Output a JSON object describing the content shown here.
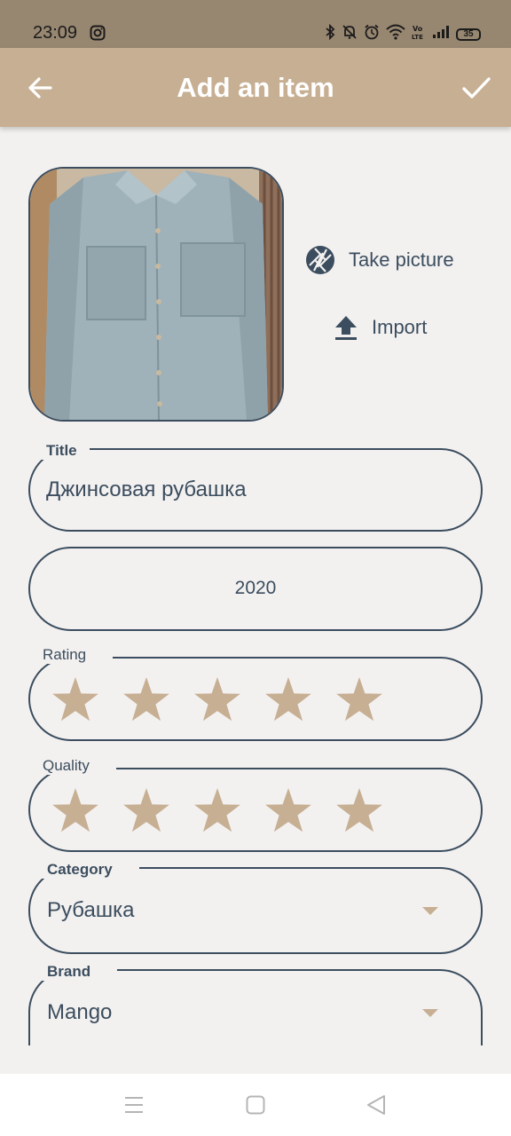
{
  "status_bar": {
    "time": "23:09",
    "battery": "35",
    "icons": [
      "instagram-icon",
      "bluetooth-icon",
      "mute-icon",
      "alarm-icon",
      "wifi-icon",
      "volte-icon",
      "signal-icon",
      "battery-icon"
    ]
  },
  "app_bar": {
    "title": "Add an item",
    "back_icon": "arrow-left-icon",
    "confirm_icon": "check-icon"
  },
  "photo": {
    "alt_icon": "shirt-photo"
  },
  "actions": {
    "take_picture": "Take picture",
    "import": "Import"
  },
  "form": {
    "title": {
      "label": "Title",
      "value": "Джинсовая рубашка"
    },
    "year": {
      "value": "2020"
    },
    "rating": {
      "label": "Rating",
      "stars": 5,
      "max": 5
    },
    "quality": {
      "label": "Quality",
      "stars": 5,
      "max": 5
    },
    "category": {
      "label": "Category",
      "value": "Рубашка"
    },
    "brand": {
      "label": "Brand",
      "value": "Mango"
    }
  },
  "colors": {
    "accent": "#c7af93",
    "text": "#3b4d5e",
    "background": "#f3f1f0",
    "status_bar": "#978670"
  },
  "nav_bar": {
    "icons": [
      "menu-icon",
      "home-icon",
      "back-icon"
    ]
  }
}
